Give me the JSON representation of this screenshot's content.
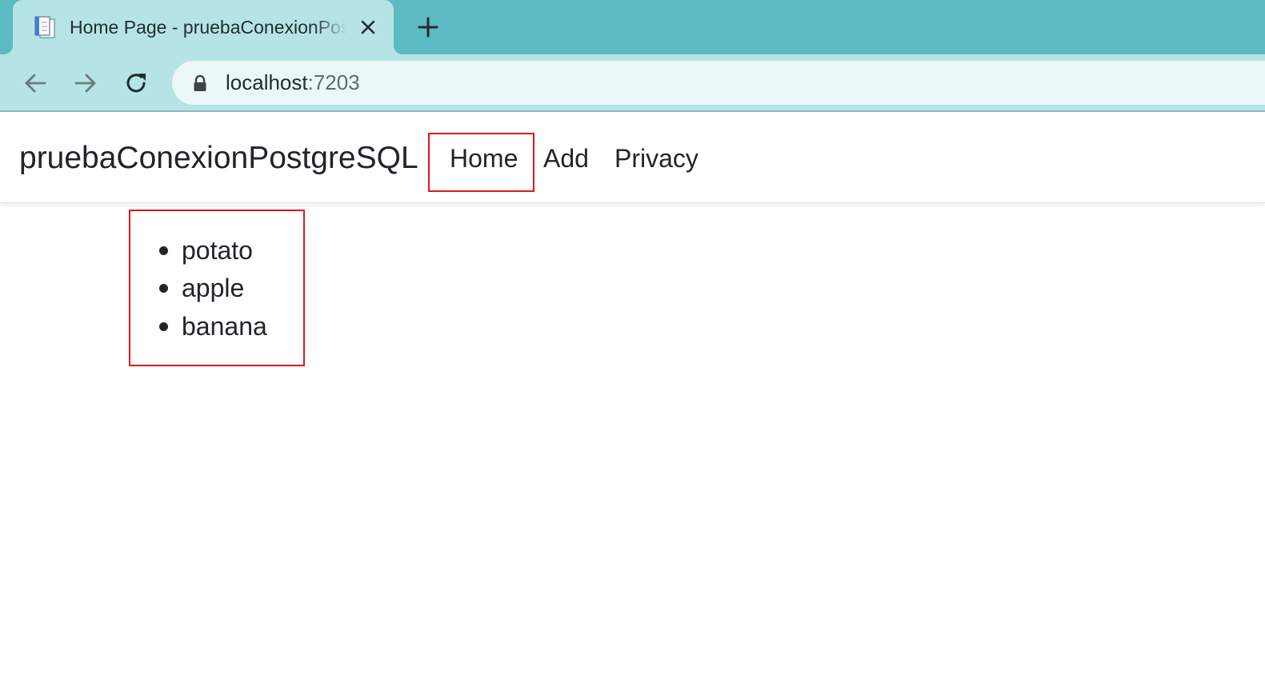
{
  "browser": {
    "tab": {
      "title": "Home Page - pruebaConexionPostgreSQL",
      "favicon": "document-favicon-icon",
      "close_icon": "close-icon"
    },
    "new_tab_icon": "plus-icon",
    "toolbar": {
      "back_icon": "arrow-left-icon",
      "forward_icon": "arrow-right-icon",
      "reload_icon": "reload-icon"
    },
    "address_bar": {
      "security_icon": "lock-icon",
      "host": "localhost",
      "port": ":7203"
    }
  },
  "navbar": {
    "brand": "pruebaConexionPostgreSQL",
    "links": [
      {
        "label": "Home",
        "highlighted": true
      },
      {
        "label": "Add"
      },
      {
        "label": "Privacy"
      }
    ]
  },
  "main": {
    "items": [
      "potato",
      "apple",
      "banana"
    ]
  },
  "colors": {
    "tabstrip": "#5cbac2",
    "active_tab": "#b6e3e6",
    "omnibox": "#ebf7f8",
    "annotation_red": "#e2161e",
    "text": "#212529"
  }
}
